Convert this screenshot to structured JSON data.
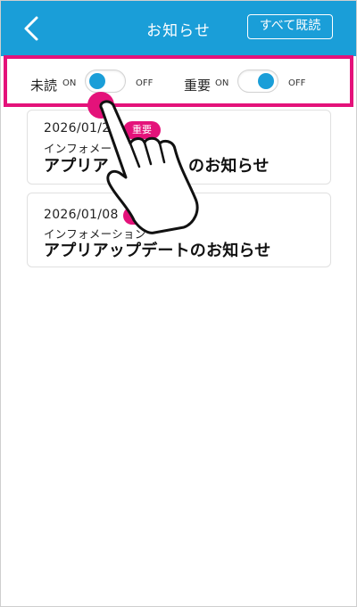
{
  "header": {
    "title": "お知らせ",
    "read_all_label": "すべて既読"
  },
  "filters": {
    "unread": {
      "label": "未読",
      "on_label": "ON",
      "off_label": "OFF",
      "state": "on"
    },
    "important": {
      "label": "重要",
      "on_label": "ON",
      "off_label": "OFF",
      "state": "on"
    }
  },
  "notices": [
    {
      "date": "2026/01/2",
      "badge": "重要",
      "category": "インフォメー",
      "title": "アプリア",
      "title_end": "のお知らせ"
    },
    {
      "date": "2026/01/08",
      "badge": "重要",
      "category": "インフォメーション",
      "title": "アプリアップデートのお知らせ"
    }
  ],
  "colors": {
    "header_bg": "#1a9ed8",
    "highlight": "#e4127a",
    "toggle_knob": "#1a9ed8"
  },
  "icons": {
    "back": "chevron-left-icon",
    "pointer": "hand-pointer-icon"
  }
}
